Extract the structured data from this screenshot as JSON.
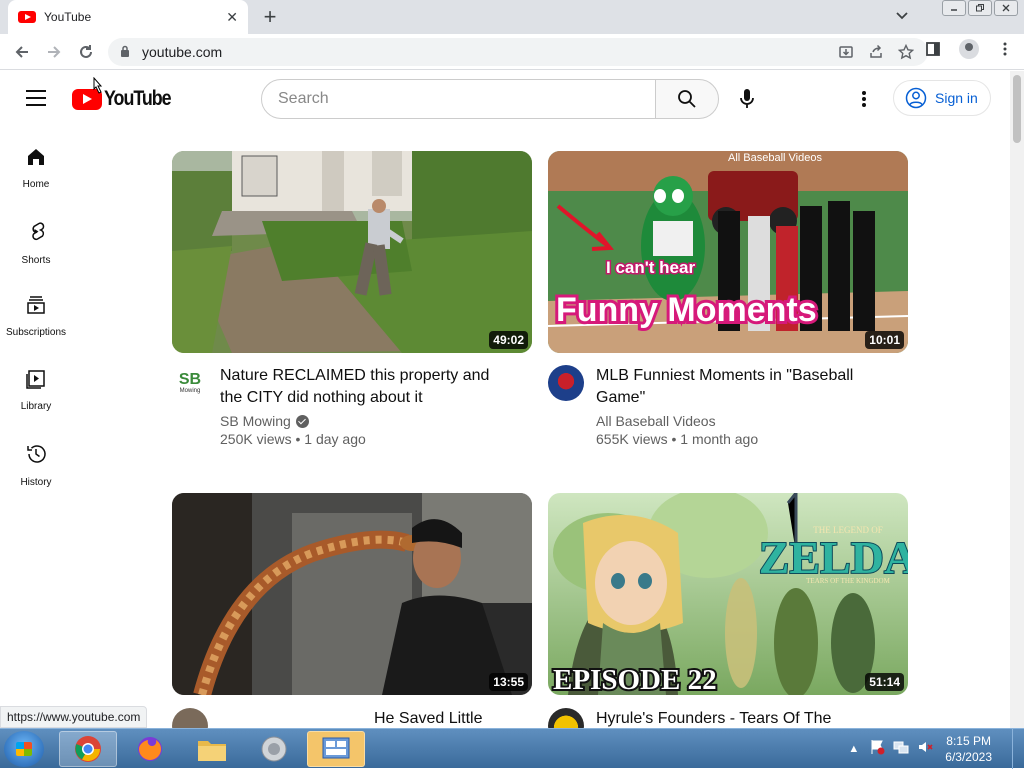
{
  "browser": {
    "tab_title": "YouTube",
    "tab_close": "✕",
    "new_tab": "+",
    "tab_menu": "⌄",
    "url": "youtube.com"
  },
  "youtube": {
    "logo_text": "YouTube",
    "search_placeholder": "Search",
    "signin_label": "Sign in"
  },
  "sidebar": {
    "items": [
      {
        "label": "Home",
        "icon": "home-icon"
      },
      {
        "label": "Shorts",
        "icon": "shorts-icon"
      },
      {
        "label": "Subscriptions",
        "icon": "subscriptions-icon"
      },
      {
        "label": "Library",
        "icon": "library-icon"
      },
      {
        "label": "History",
        "icon": "history-icon"
      }
    ]
  },
  "videos": [
    {
      "title": "Nature RECLAIMED this property and the CITY did nothing about it",
      "channel": "SB Mowing",
      "verified": true,
      "meta": "250K views • 1 day ago",
      "duration": "49:02"
    },
    {
      "title": "MLB Funniest Moments in \"Baseball Game\"",
      "channel": "All Baseball Videos",
      "verified": false,
      "meta": "655K views • 1 month ago",
      "duration": "10:01",
      "thumb_watermark": "All Baseball Videos",
      "thumb_caption": "I can't hear",
      "thumb_headline": "Funny Moments"
    },
    {
      "title": "He Saved Little Snake",
      "duration": "13:55"
    },
    {
      "title": "Hyrule's Founders - Tears Of The",
      "duration": "51:14",
      "thumb_logo_main": "ZELDA",
      "thumb_logo_top": "THE LEGEND OF",
      "thumb_logo_sub": "TEARS OF THE KINGDOM",
      "thumb_episode": "EPISODE 22"
    }
  ],
  "status_url": "https://www.youtube.com",
  "taskbar": {
    "time": "8:15 PM",
    "date": "6/3/2023"
  },
  "sb_avatar_text": "SB",
  "sb_avatar_sub": "Mowing"
}
